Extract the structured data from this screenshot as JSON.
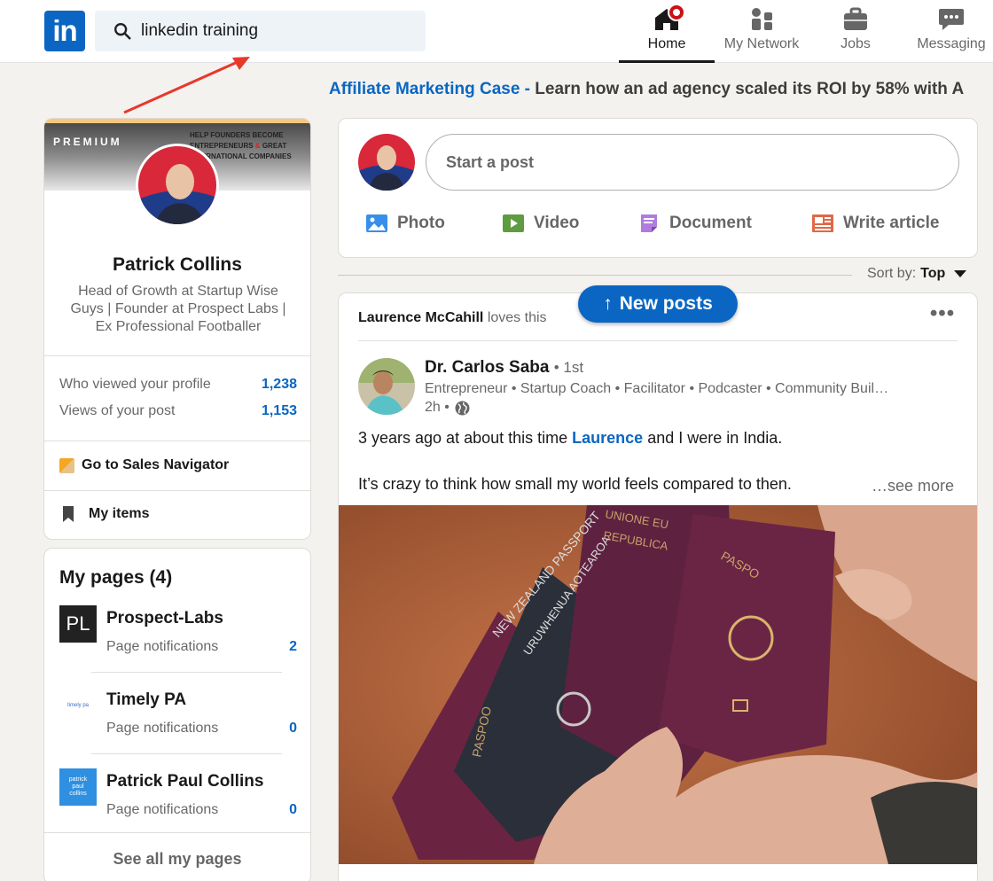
{
  "colors": {
    "brand": "#0a66c2",
    "notification": "#cc1016",
    "premium_accent": "#f8c77e"
  },
  "nav": {
    "logo": "in",
    "search_value": "linkedin training",
    "items": [
      {
        "label": "Home",
        "icon": "home-icon"
      },
      {
        "label": "My Network",
        "icon": "network-icon"
      },
      {
        "label": "Jobs",
        "icon": "briefcase-icon"
      },
      {
        "label": "Messaging",
        "icon": "messaging-icon"
      }
    ]
  },
  "promo": {
    "link": "Affiliate Marketing Case -",
    "text": " Learn how an ad agency scaled its ROI by 58% with A"
  },
  "profile": {
    "premium": "PREMIUM",
    "banner_text_1": "HELP FOUNDERS BECOME ENTREPRENEURS",
    "banner_text_2": "&",
    "banner_text_3": "GREAT INTERNATIONAL COMPANIES",
    "name": "Patrick Collins",
    "headline": "Head of Growth at Startup Wise Guys | Founder at Prospect Labs | Ex Professional Footballer",
    "stats": [
      {
        "label": "Who viewed your profile",
        "value": "1,238"
      },
      {
        "label": "Views of your post",
        "value": "1,153"
      }
    ],
    "sales_navigator": "Go to Sales Navigator",
    "my_items": "My items"
  },
  "pages": {
    "title": "My pages (4)",
    "items": [
      {
        "name": "Prospect-Labs",
        "logo": "PL",
        "notif_label": "Page notifications",
        "count": "2"
      },
      {
        "name": "Timely PA",
        "logo": "timely pa",
        "notif_label": "Page notifications",
        "count": "0"
      },
      {
        "name": "Patrick Paul Collins",
        "logo": "patrick paul collins",
        "notif_label": "Page notifications",
        "count": "0"
      }
    ],
    "see_all": "See all my pages"
  },
  "share": {
    "placeholder": "Start a post",
    "actions": [
      {
        "label": "Photo",
        "icon": "photo-icon",
        "color": "#378fe9"
      },
      {
        "label": "Video",
        "icon": "video-icon",
        "color": "#5f9b41"
      },
      {
        "label": "Document",
        "icon": "document-icon",
        "color": "#c37d16"
      },
      {
        "label": "Write article",
        "icon": "article-icon",
        "color": "#e06847"
      }
    ]
  },
  "sort": {
    "label": "Sort by:",
    "value": "Top"
  },
  "new_posts": "New posts",
  "post": {
    "activity_name": "Laurence McCahill",
    "activity_text": "loves this",
    "author": "Dr. Carlos Saba",
    "degree": "• 1st",
    "headline": "Entrepreneur • Startup Coach • Facilitator • Podcaster • Community Buil…",
    "time": "2h •",
    "text1_before": "3 years ago at about this time ",
    "text1_mention": "Laurence",
    "text1_after": " and I were in India.",
    "text2": "It’s crazy to think how small my world feels compared to then.",
    "see_more": "…see more",
    "passport_text_1": "NEW ZEALAND PASSPORT",
    "passport_text_2": "URUWHENUA AOTEAROA",
    "passport_text_3": "PASPOO",
    "passport_text_4": "PASPO",
    "passport_text_5": "REPUBLICA",
    "passport_text_6": "UNIONE EU"
  }
}
